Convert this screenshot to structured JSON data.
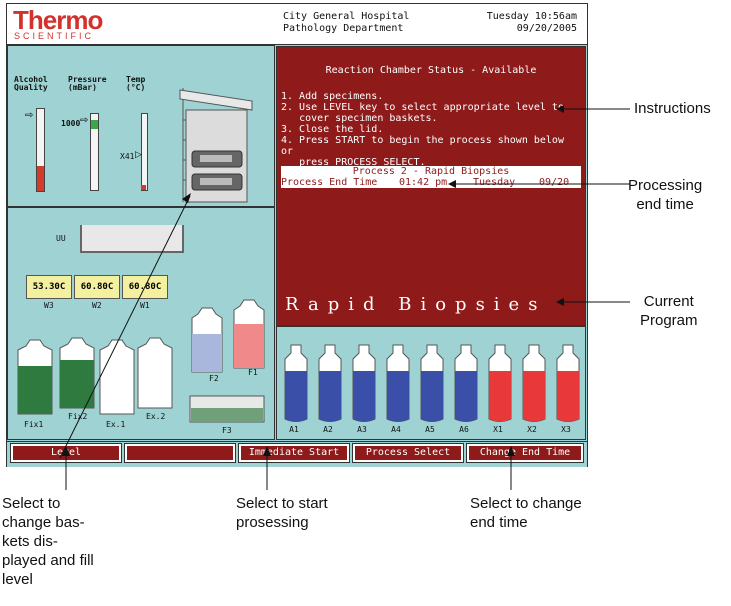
{
  "header": {
    "logo_main": "Thermo",
    "logo_sub": "SCIENTIFIC",
    "hospital": "City General Hospital\nPathology Department",
    "datetime": "Tuesday 10:56am\n09/20/2005"
  },
  "gauges": {
    "alcohol_label": "Alcohol\nQuality",
    "pressure_label": "Pressure\n(mBar)",
    "temp_label": "Temp\n(°C)",
    "pressure_value": "1000",
    "temp_marker": "X41",
    "alcohol_level": 0.3
  },
  "baths": {
    "top_label": "UU",
    "temps": [
      "53.30C",
      "60.80C",
      "60.80C"
    ],
    "labels": [
      "W3",
      "W2",
      "W1"
    ]
  },
  "containers": {
    "labels": [
      "Fix1",
      "Fix2",
      "Ex.1",
      "Ex.2",
      "F2",
      "F1",
      "F3"
    ]
  },
  "status": {
    "title": "Reaction Chamber Status - Available",
    "steps": [
      "1. Add specimens.",
      "2. Use LEVEL key to select appropriate level to\n   cover specimen baskets.",
      "3. Close the lid.",
      "4. Press START to begin the process shown below or\n   press PROCESS SELECT."
    ],
    "process_name": "Process 2 - Rapid Biopsies",
    "process_end_label": "Process End Time",
    "end_time": "01:42 pm",
    "end_day": "Tuesday",
    "end_date": "09/20",
    "program": "Rapid Biopsies"
  },
  "bottles": {
    "labels": [
      "A1",
      "A2",
      "A3",
      "A4",
      "A5",
      "A6",
      "X1",
      "X2",
      "X3"
    ],
    "colors": [
      "blue",
      "blue",
      "blue",
      "blue",
      "blue",
      "blue",
      "red",
      "red",
      "red"
    ],
    "blue": "#3a4fa8",
    "red": "#e8383a"
  },
  "softkeys": [
    "Level",
    "",
    "Immediate Start",
    "Process Select",
    "Change End Time"
  ],
  "annotations": {
    "instructions": "Instructions",
    "processing_end": "Processing\nend time",
    "current_program": "Current\nProgram",
    "select_level": "Select to\nchange bas-\nkets dis-\nplayed and fill\nlevel",
    "select_start": "Select to start\nprosessing",
    "select_change": "Select to change\nend time"
  },
  "colors": {
    "panel_bg": "#9fd3d3",
    "status_red": "#8e1a1a",
    "logo_red": "#d2322d"
  }
}
